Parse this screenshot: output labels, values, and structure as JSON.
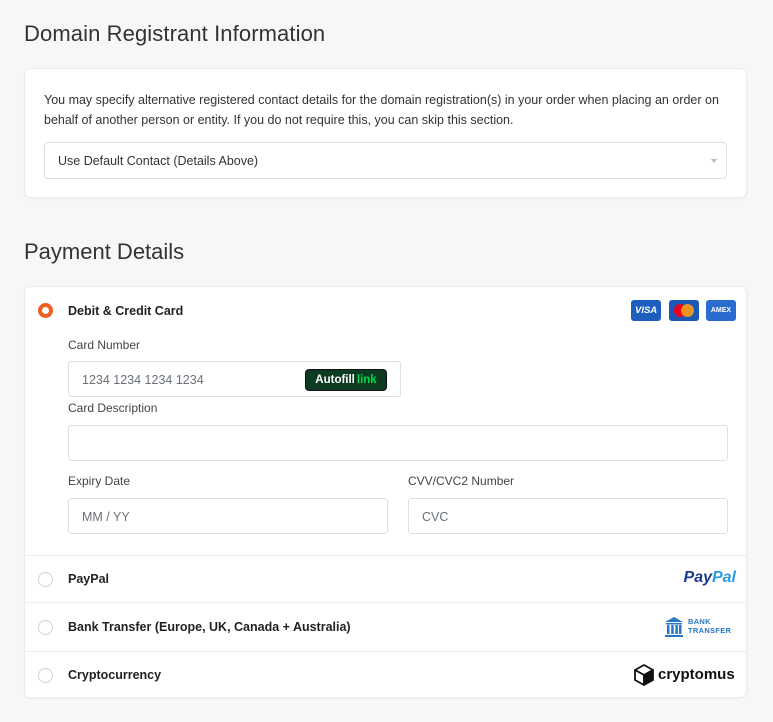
{
  "registrant": {
    "title": "Domain Registrant Information",
    "description": "You may specify alternative registered contact details for the domain registration(s) in your order when placing an order on behalf of another person or entity. If you do not require this, you can skip this section.",
    "contact_select_value": "Use Default Contact (Details Above)"
  },
  "payment": {
    "title": "Payment Details",
    "methods": [
      {
        "label": "Debit & Credit Card",
        "selected": true
      },
      {
        "label": "PayPal",
        "selected": false
      },
      {
        "label": "Bank Transfer (Europe, UK, Canada + Australia)",
        "selected": false
      },
      {
        "label": "Cryptocurrency",
        "selected": false
      }
    ],
    "card_logos": [
      "VISA",
      "",
      "AMEX"
    ],
    "card_form": {
      "card_number_label": "Card Number",
      "card_number_placeholder": "1234 1234 1234 1234",
      "autofill_text": "Autofill",
      "autofill_link": "link",
      "card_description_label": "Card Description",
      "expiry_label": "Expiry Date",
      "expiry_placeholder": "MM / YY",
      "cvv_label": "CVV/CVC2 Number",
      "cvv_placeholder": "CVC"
    },
    "paypal_logo": {
      "part1": "Pay",
      "part2": "Pal"
    },
    "bank_logo": {
      "line1": "BANK",
      "line2": "TRANSFER"
    },
    "crypto_logo": "cryptomus"
  },
  "colors": {
    "accent": "#f05f22",
    "paypal_dark": "#1b3a8a",
    "paypal_light": "#2a9de0",
    "bank_blue": "#2876c6",
    "link_green": "#00d64f"
  }
}
